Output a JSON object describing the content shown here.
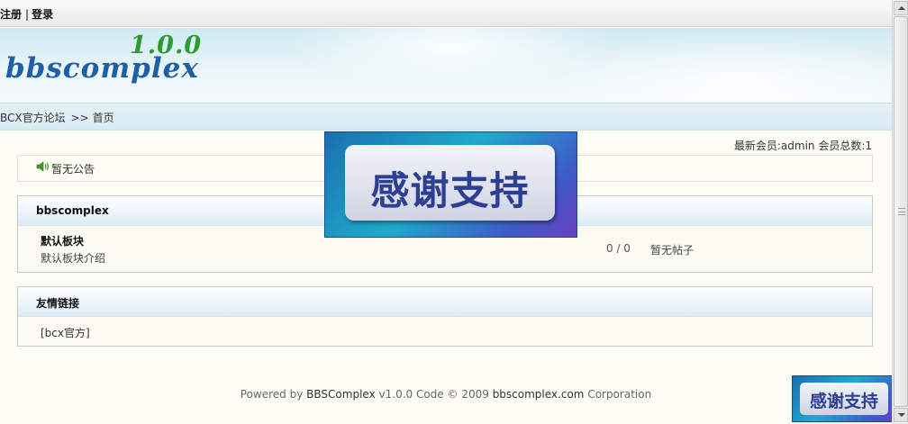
{
  "topbar": {
    "register_label": "注册",
    "separator": "|",
    "login_label": "登录"
  },
  "logo": {
    "name": "bbscomplex",
    "version": "1.0.0"
  },
  "breadcrumb": {
    "site": "BCX官方论坛",
    "arrows": ">>",
    "current": "首页"
  },
  "stats": {
    "text": "最新会员:admin 会员总数:1"
  },
  "notice": {
    "icon": "speaker-icon",
    "text": "暂无公告"
  },
  "forum_section": {
    "title": "bbscomplex",
    "boards": [
      {
        "name": "默认板块",
        "description": "默认板块介绍",
        "counts": "0 / 0",
        "last_post": "暂无帖子"
      }
    ]
  },
  "links_section": {
    "title": "友情链接",
    "items": [
      "[bcx官方]"
    ]
  },
  "footer": {
    "powered_by": "Powered by",
    "product": "BBSComplex",
    "version_code": "v1.0.0 Code © 2009",
    "domain": "bbscomplex.com",
    "corp": "Corporation"
  },
  "overlay": {
    "thanks_text": "感谢支持"
  },
  "colors": {
    "logo_blue": "#1f5fa8",
    "logo_green": "#2f9a2f",
    "banner_bg": "#cfeaf4",
    "overlay_text": "#2d3f93"
  }
}
